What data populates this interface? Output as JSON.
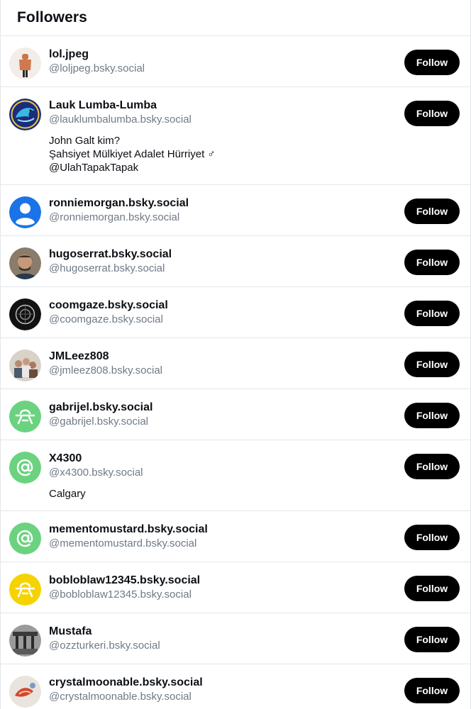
{
  "header": {
    "title": "Followers"
  },
  "colors": {
    "follow_bg": "#000000",
    "handle": "#6f7a86",
    "divider": "#e3e6ea",
    "green_avatar": "#6bd27f",
    "blue_avatar": "#1a73e8",
    "yellow_avatar": "#f5d300"
  },
  "followers": [
    {
      "name": "lol.jpeg",
      "handle": "@loljpeg.bsky.social",
      "button": "Follow",
      "avatar": "figure-photo"
    },
    {
      "name": "Lauk Lumba-Lumba",
      "handle": "@lauklumbalumba.bsky.social",
      "button": "Follow",
      "avatar": "dolphin-art",
      "bio": [
        "John Galt kim?",
        "Şahsiyet Mülkiyet Adalet Hürriyet ♂",
        "@UlahTapakTapak"
      ]
    },
    {
      "name": "ronniemorgan.bsky.social",
      "handle": "@ronniemorgan.bsky.social",
      "button": "Follow",
      "avatar": "default-user-blue"
    },
    {
      "name": "hugoserrat.bsky.social",
      "handle": "@hugoserrat.bsky.social",
      "button": "Follow",
      "avatar": "person-photo"
    },
    {
      "name": "coomgaze.bsky.social",
      "handle": "@coomgaze.bsky.social",
      "button": "Follow",
      "avatar": "dark-emblem"
    },
    {
      "name": "JMLeez808",
      "handle": "@jmleez808.bsky.social",
      "button": "Follow",
      "avatar": "group-photo"
    },
    {
      "name": "gabrijel.bsky.social",
      "handle": "@gabrijel.bsky.social",
      "button": "Follow",
      "avatar": "green-ufo"
    },
    {
      "name": "X4300",
      "handle": "@x4300.bsky.social",
      "button": "Follow",
      "avatar": "green-at",
      "bio": [
        "Calgary"
      ]
    },
    {
      "name": "mementomustard.bsky.social",
      "handle": "@mementomustard.bsky.social",
      "button": "Follow",
      "avatar": "green-at"
    },
    {
      "name": "bobloblaw12345.bsky.social",
      "handle": "@bobloblaw12345.bsky.social",
      "button": "Follow",
      "avatar": "yellow-ufo"
    },
    {
      "name": "Mustafa",
      "handle": "@ozzturkeri.bsky.social",
      "button": "Follow",
      "avatar": "bw-photo"
    },
    {
      "name": "crystalmoonable.bsky.social",
      "handle": "@crystalmoonable.bsky.social",
      "button": "Follow",
      "avatar": "crystal-photo"
    }
  ]
}
